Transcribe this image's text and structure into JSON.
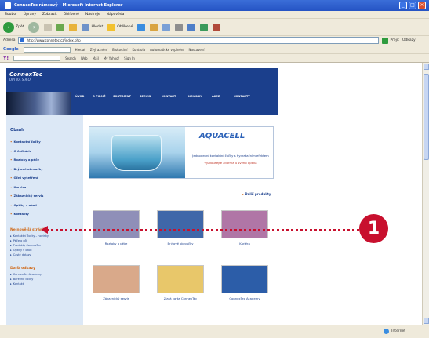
{
  "window": {
    "title": "ConnexTec rámcový – Microsoft Internet Explorer",
    "controls": [
      "_",
      "□",
      "×"
    ]
  },
  "menubar": [
    "Soubor",
    "Úpravy",
    "Zobrazit",
    "Oblíbené",
    "Nástroje",
    "Nápověda"
  ],
  "toolbar": {
    "back_label": "Zpět",
    "search_label": "Hledat",
    "favorites_label": "Oblíbené"
  },
  "address": {
    "label": "Adresa",
    "value": "http://www.connetec.cz/index.php",
    "go_label": "Přejít",
    "links_label": "Odkazy"
  },
  "google_bar": {
    "logo": "Google",
    "items": [
      "Hledat",
      "Zvýraznění",
      "Blokování",
      "Kontrola",
      "Automatické vyplnění",
      "Nastavení"
    ]
  },
  "yahoo_bar": {
    "logo": "Y!",
    "items": [
      "Search",
      "Web",
      "Mail",
      "My Yahoo!",
      "Sign In"
    ]
  },
  "site": {
    "brand": "ConnexTec",
    "brand_sub": "OPTIKA S.R.O.",
    "nav": [
      "ÚVOD",
      "O FIRMĚ",
      "SORTIMENT",
      "SERVIS",
      "KONTAKT",
      "NOVINKY",
      "AKCE",
      "KONTAKTY"
    ],
    "sidebar": {
      "heading": "Obsah",
      "items": [
        "Kontaktní čočky",
        "O čočkách",
        "Roztoky a péče",
        "Brýlové obroučky",
        "Oční vyšetření",
        "Kariéra",
        "Zákaznický servis",
        "Optiky v okolí",
        "Kontakty"
      ],
      "sub_heading": "Nejnovější stránky",
      "sub_items": [
        "Kontaktní čočky – novinky",
        "Péče o oči",
        "Produkty ConnexTec",
        "Optiky v okolí",
        "Časté dotazy"
      ],
      "sub_heading2": "Další odkazy",
      "sub_items2": [
        "ConnexTec Academy",
        "Barevné čočky",
        "Kontakt"
      ]
    },
    "banner": {
      "brand": "AQUACELL",
      "text1": "Jednodenní kontaktní čočky s hydratačním efektem",
      "text2": "Vyzkoušejte zdarma u svého optika"
    },
    "more_link": "Další produkty",
    "thumbs": [
      {
        "caption": "Roztoky a péče",
        "color": "#8f8fb8"
      },
      {
        "caption": "Brýlové obroučky",
        "color": "#3f67a9"
      },
      {
        "caption": "Kariéra",
        "color": "#b076a6"
      },
      {
        "caption": "Zákaznický servis",
        "color": "#d9a98a"
      },
      {
        "caption": "Zlatá karta ConnexTec",
        "color": "#e8c76a"
      },
      {
        "caption": "ConnexTec Academy",
        "color": "#2c5da8"
      }
    ]
  },
  "status": {
    "zone": "Internet"
  },
  "annotation": {
    "number": "1",
    "color": "#c8102e"
  }
}
